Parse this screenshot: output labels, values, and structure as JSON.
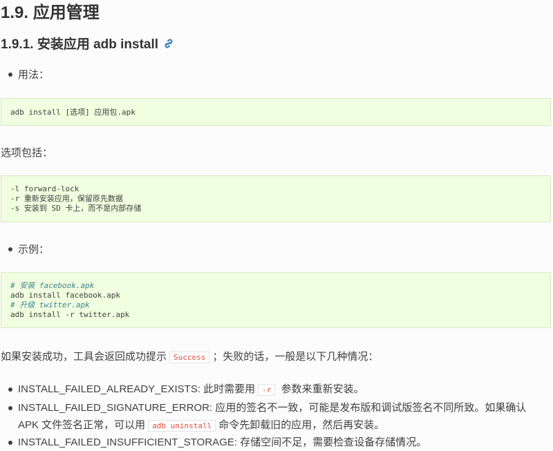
{
  "section_title": "1.9. 应用管理",
  "subsection_title": "1.9.1. 安装应用 adb install",
  "usage_label": "用法：",
  "usage_code": "adb install [选项] 应用包.apk",
  "options_label": "选项包括：",
  "options_code": [
    "-l forward-lock",
    "-r 重新安装应用，保留原先数据",
    "-s 安装到 SD 卡上，而不是内部存储"
  ],
  "example_label": "示例：",
  "example_code": [
    {
      "text": "# 安装 facebook.apk",
      "comment": true
    },
    {
      "text": "adb install facebook.apk",
      "comment": false
    },
    {
      "text": "# 升级 twitter.apk",
      "comment": true
    },
    {
      "text": "adb install -r twitter.apk",
      "comment": false
    }
  ],
  "result_para": {
    "before": "如果安装成功，工具会返回成功提示",
    "code": "Success",
    "after": "；失败的话，一般是以下几种情况："
  },
  "errors": [
    {
      "name": "INSTALL_FAILED_ALREADY_EXISTS:",
      "before": " 此时需要用",
      "code": "-r",
      "after": " 参数来重新安装。"
    },
    {
      "name": "INSTALL_FAILED_SIGNATURE_ERROR:",
      "before": " 应用的签名不一致，可能是发布版和调试版签名不同所致。如果确认 APK 文件签名正常，可以用",
      "code": "adb uninstall",
      "after": "命令先卸载旧的应用，然后再安装。"
    },
    {
      "name": "INSTALL_FAILED_INSUFFICIENT_STORAGE:",
      "before": " 存储空间不足，需要检查设备存储情况。",
      "code": "",
      "after": ""
    }
  ]
}
